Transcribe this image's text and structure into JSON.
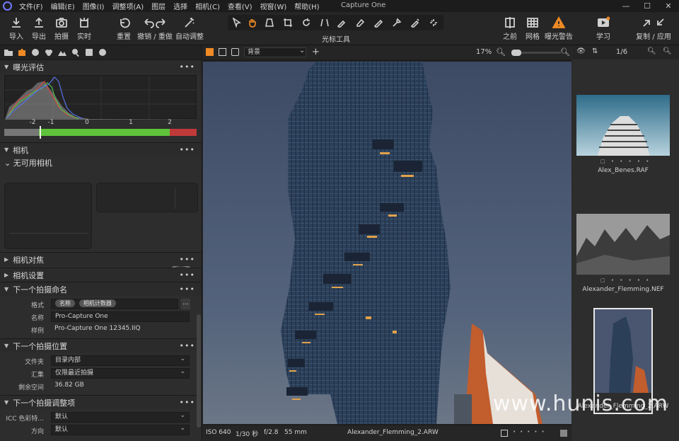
{
  "menubar": {
    "items": [
      "文件(F)",
      "编辑(E)",
      "图像(I)",
      "调整项(A)",
      "图层",
      "选择",
      "相机(C)",
      "查看(V)",
      "视窗(W)",
      "帮助(H)"
    ],
    "app_title": "Capture One",
    "window_buttons": [
      "—",
      "☐",
      "✕"
    ]
  },
  "toolbar": {
    "import": "导入",
    "export": "导出",
    "capture": "拍摄",
    "live": "实时",
    "reset": "重置",
    "undo_redo": "撤销 / 重做",
    "auto_adjust": "自动调整",
    "cursor_tools": "光标工具",
    "before": "之前",
    "grid": "网格",
    "exposure_warning": "曝光警告",
    "learn": "学习",
    "copy_apply": "复制 / 应用"
  },
  "left": {
    "exposure_section": "曝光评估",
    "histogram_scale": [
      "-2",
      "-1",
      "0",
      "1",
      "2"
    ],
    "camera_section": "相机",
    "no_camera": "无可用相机",
    "camera_focus": "相机对焦",
    "camera_settings": "相机设置",
    "next_capture_naming": "下一个拍摄命名",
    "format_label": "格式",
    "format_tags": [
      "名称",
      "相机计数器"
    ],
    "format_more": "...",
    "name_label": "名称",
    "name_value": "Pro-Capture One",
    "sample_label": "样例",
    "sample_value": "Pro-Capture One 12345.IIQ",
    "next_capture_location": "下一个拍摄位置",
    "folder_label": "文件夹",
    "folder_value": "目录内部",
    "collection_label": "汇集",
    "collection_value": "仅限最近拍摄",
    "space_label": "剩余空间",
    "space_value": "36.82 GB",
    "next_capture_adjust": "下一个拍摄调整项",
    "icc_label": "ICC 色彩特...",
    "icc_value": "默认",
    "orient_label": "方向",
    "orient_value": "默认",
    "section_dots": "•••"
  },
  "viewer": {
    "background_select": "背景",
    "zoom": "17%",
    "status": {
      "iso": "ISO 640",
      "shutter": "1/30 秒",
      "aperture": "f/2.8",
      "focal": "55 mm",
      "filename": "Alexander_Flemming_2.ARW"
    }
  },
  "browser": {
    "counter": "1/6",
    "thumbnails": [
      "Alex_Benes.RAF",
      "Alexander_Flemming.NEF",
      "Alexander_Flemming_2.ARW"
    ]
  },
  "watermark": "www.hunis.com",
  "colors": {
    "accent": "#f08a24",
    "exposure_green": "#5fc23a",
    "exposure_red": "#c03a3a"
  }
}
